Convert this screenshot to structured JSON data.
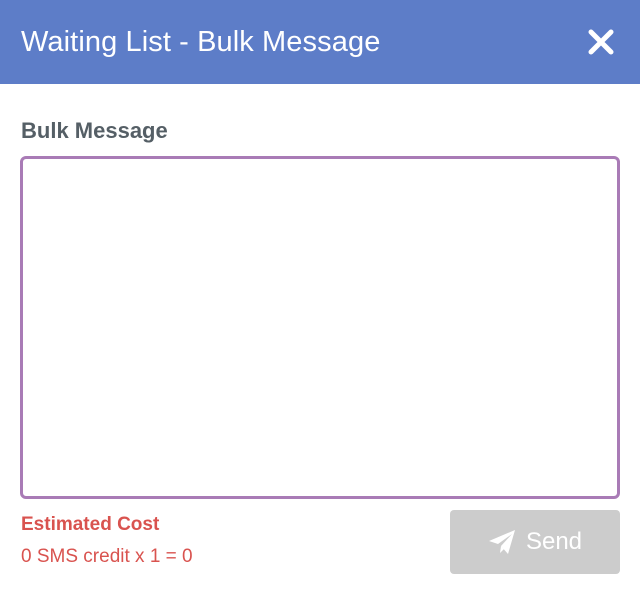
{
  "header": {
    "title": "Waiting List - Bulk Message",
    "close_icon": "close-icon",
    "background_color": "#5d7dc8"
  },
  "form": {
    "message_label": "Bulk Message",
    "message_value": "",
    "message_placeholder": "",
    "border_color": "#a97bb6"
  },
  "cost": {
    "label": "Estimated Cost",
    "value": "0 SMS credit x 1 = 0",
    "color": "#d9534f"
  },
  "actions": {
    "send_label": "Send",
    "send_icon": "paper-plane-icon",
    "send_disabled": true,
    "send_color": "#cccccc"
  }
}
